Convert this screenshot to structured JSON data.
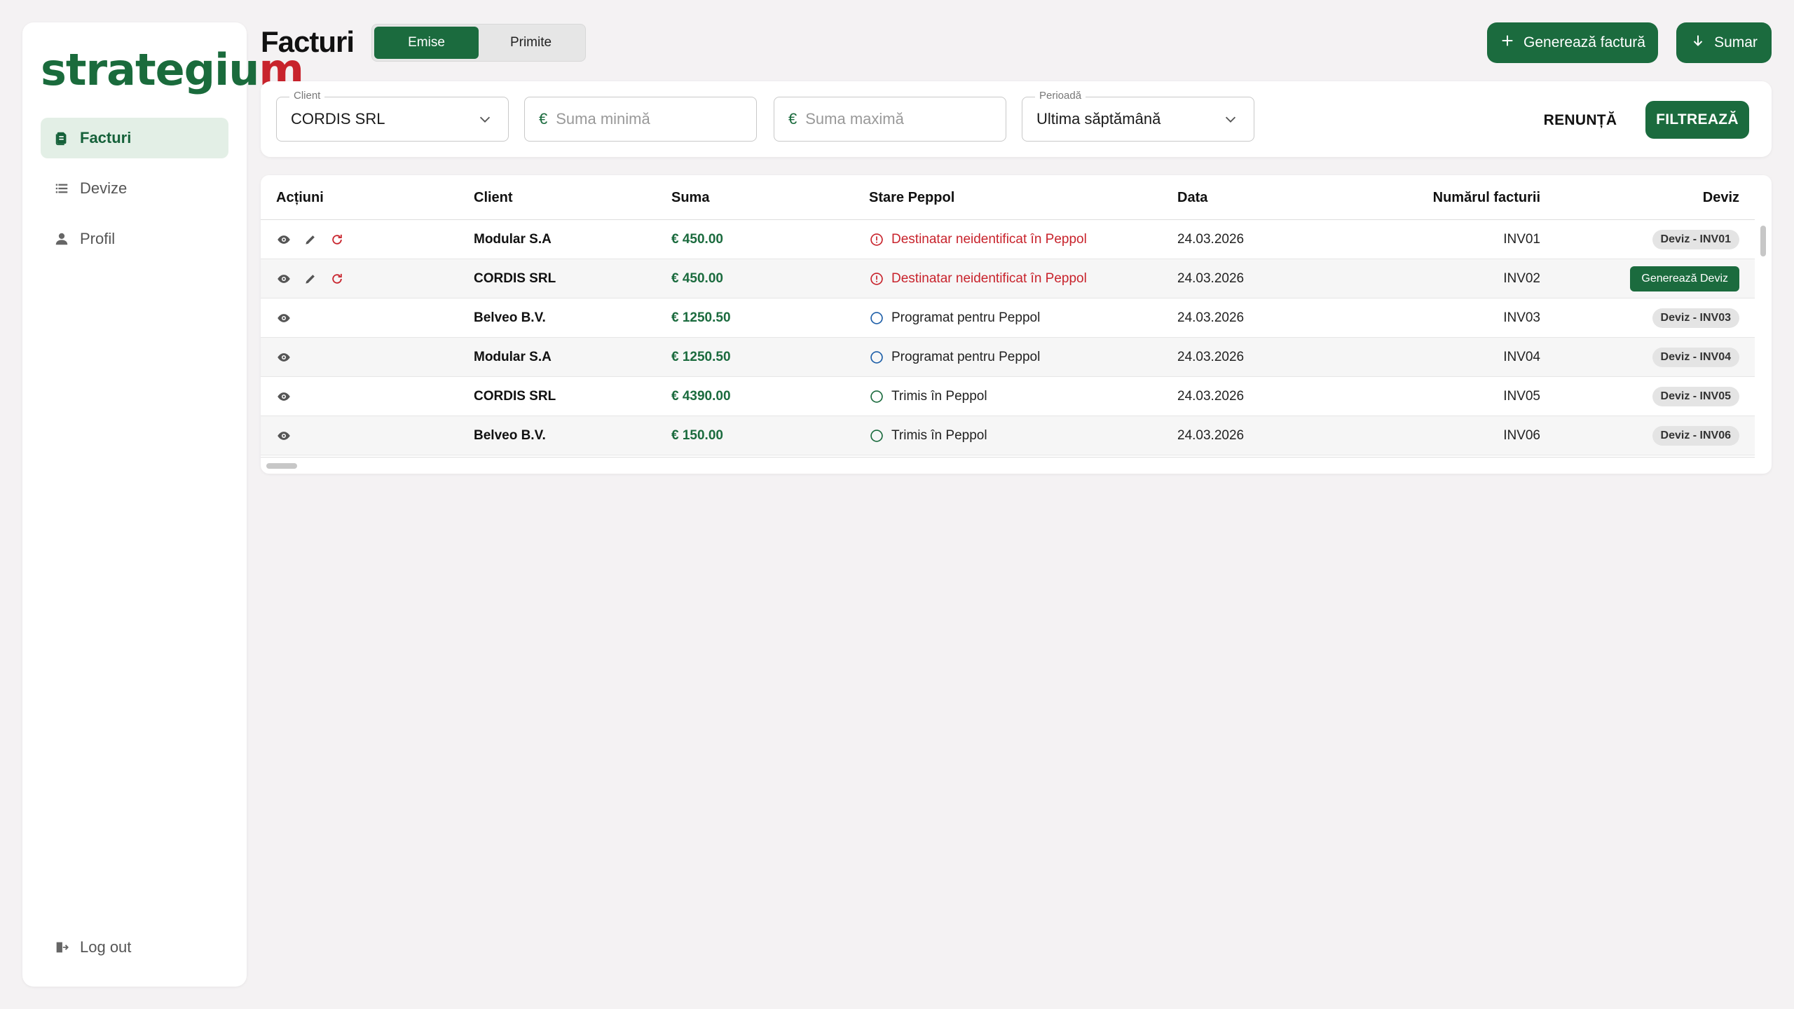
{
  "brand": {
    "logo_main": "strategiu",
    "logo_accent": "m"
  },
  "sidebar": {
    "items": [
      {
        "label": "Facturi",
        "icon": "invoice-icon",
        "active": true
      },
      {
        "label": "Devize",
        "icon": "list-icon",
        "active": false
      },
      {
        "label": "Profil",
        "icon": "person-icon",
        "active": false
      }
    ],
    "logout_label": "Log out"
  },
  "header": {
    "title": "Facturi",
    "tabs": [
      {
        "label": "Emise",
        "selected": true
      },
      {
        "label": "Primite",
        "selected": false
      }
    ],
    "generate_label": "Generează factură",
    "sumar_label": "Sumar"
  },
  "filters": {
    "client": {
      "legend": "Client",
      "value": "CORDIS SRL"
    },
    "min": {
      "currency": "€",
      "placeholder": "Suma minimă"
    },
    "max": {
      "currency": "€",
      "placeholder": "Suma maximă"
    },
    "period": {
      "legend": "Perioadă",
      "value": "Ultima săptămână"
    },
    "cancel_label": "RENUNȚĂ",
    "filter_label": "FILTREAZĂ"
  },
  "table": {
    "headers": {
      "actions": "Acțiuni",
      "client": "Client",
      "suma": "Suma",
      "stare": "Stare Peppol",
      "data": "Data",
      "numar": "Numărul facturii",
      "deviz": "Deviz"
    },
    "rows": [
      {
        "client": "Modular S.A",
        "suma": "€ 450.00",
        "stare": "Destinatar neidentificat în Peppol",
        "stare_type": "error",
        "data": "24.03.2026",
        "numar": "INV01",
        "deviz": "Deviz - INV01",
        "deviz_type": "chip",
        "editable": true
      },
      {
        "client": "CORDIS SRL",
        "suma": "€ 450.00",
        "stare": "Destinatar neidentificat în Peppol",
        "stare_type": "error",
        "data": "24.03.2026",
        "numar": "INV02",
        "deviz": "Generează Deviz",
        "deviz_type": "button",
        "editable": true
      },
      {
        "client": "Belveo B.V.",
        "suma": "€ 1250.50",
        "stare": "Programat pentru Peppol",
        "stare_type": "scheduled",
        "data": "24.03.2026",
        "numar": "INV03",
        "deviz": "Deviz - INV03",
        "deviz_type": "chip",
        "editable": false
      },
      {
        "client": "Modular S.A",
        "suma": "€ 1250.50",
        "stare": "Programat pentru Peppol",
        "stare_type": "scheduled",
        "data": "24.03.2026",
        "numar": "INV04",
        "deviz": "Deviz - INV04",
        "deviz_type": "chip",
        "editable": false
      },
      {
        "client": "CORDIS SRL",
        "suma": "€ 4390.00",
        "stare": "Trimis în Peppol",
        "stare_type": "sent",
        "data": "24.03.2026",
        "numar": "INV05",
        "deviz": "Deviz - INV05",
        "deviz_type": "chip",
        "editable": false
      },
      {
        "client": "Belveo B.V.",
        "suma": "€ 150.00",
        "stare": "Trimis în Peppol",
        "stare_type": "sent",
        "data": "24.03.2026",
        "numar": "INV06",
        "deviz": "Deviz - INV06",
        "deviz_type": "chip",
        "editable": false
      }
    ]
  },
  "colors": {
    "accent": "#1b6b3e",
    "error": "#c8232c",
    "scheduled": "#1e5fa8",
    "sent": "#1b6b3e",
    "background": "#f4f2f3"
  }
}
